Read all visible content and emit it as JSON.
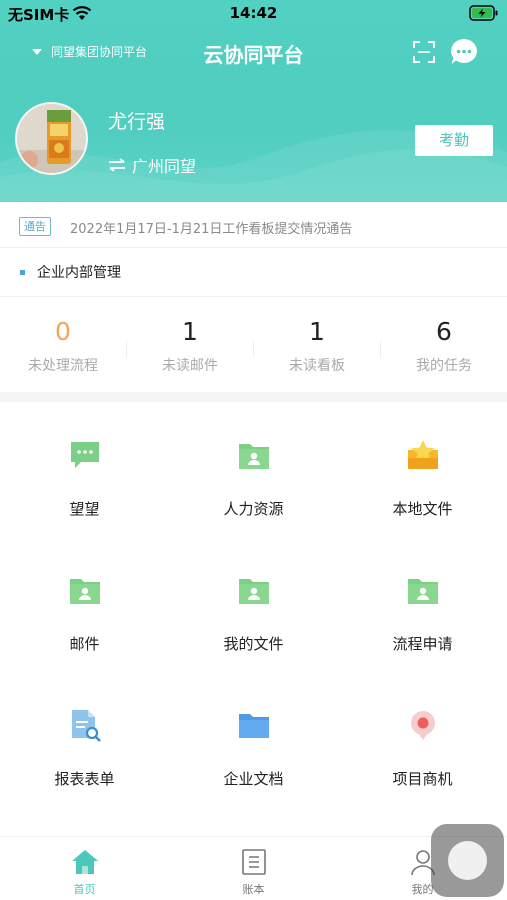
{
  "status_bar": {
    "carrier": "无SIM卡",
    "time": "14:42"
  },
  "nav": {
    "org": "同望集团协同平台",
    "title": "云协同平台"
  },
  "profile": {
    "name": "尤行强",
    "company": "广州同望",
    "attend_label": "考勤"
  },
  "notice": {
    "badge": "通告",
    "text": "2022年1月17日-1月21日工作看板提交情况通告"
  },
  "section": {
    "title": "企业内部管理"
  },
  "stats": [
    {
      "value": "0",
      "label": "未处理流程"
    },
    {
      "value": "1",
      "label": "未读邮件"
    },
    {
      "value": "1",
      "label": "未读看板"
    },
    {
      "value": "6",
      "label": "我的任务"
    }
  ],
  "grid": [
    {
      "label": "望望",
      "icon": "chat-bubble-icon"
    },
    {
      "label": "人力资源",
      "icon": "folder-person-icon"
    },
    {
      "label": "本地文件",
      "icon": "star-folder-icon"
    },
    {
      "label": "邮件",
      "icon": "folder-person-icon"
    },
    {
      "label": "我的文件",
      "icon": "folder-person-icon"
    },
    {
      "label": "流程申请",
      "icon": "folder-person-icon"
    },
    {
      "label": "报表表单",
      "icon": "document-search-icon"
    },
    {
      "label": "企业文档",
      "icon": "blue-folder-icon"
    },
    {
      "label": "项目商机",
      "icon": "location-pin-icon"
    }
  ],
  "tabs": [
    {
      "label": "首页",
      "icon": "home-icon"
    },
    {
      "label": "账本",
      "icon": "ledger-icon"
    },
    {
      "label": "我的",
      "icon": "person-icon"
    }
  ],
  "colors": {
    "accent": "#4fcdbf",
    "orange": "#f2a65a",
    "notice_blue": "#5aa8d6"
  }
}
